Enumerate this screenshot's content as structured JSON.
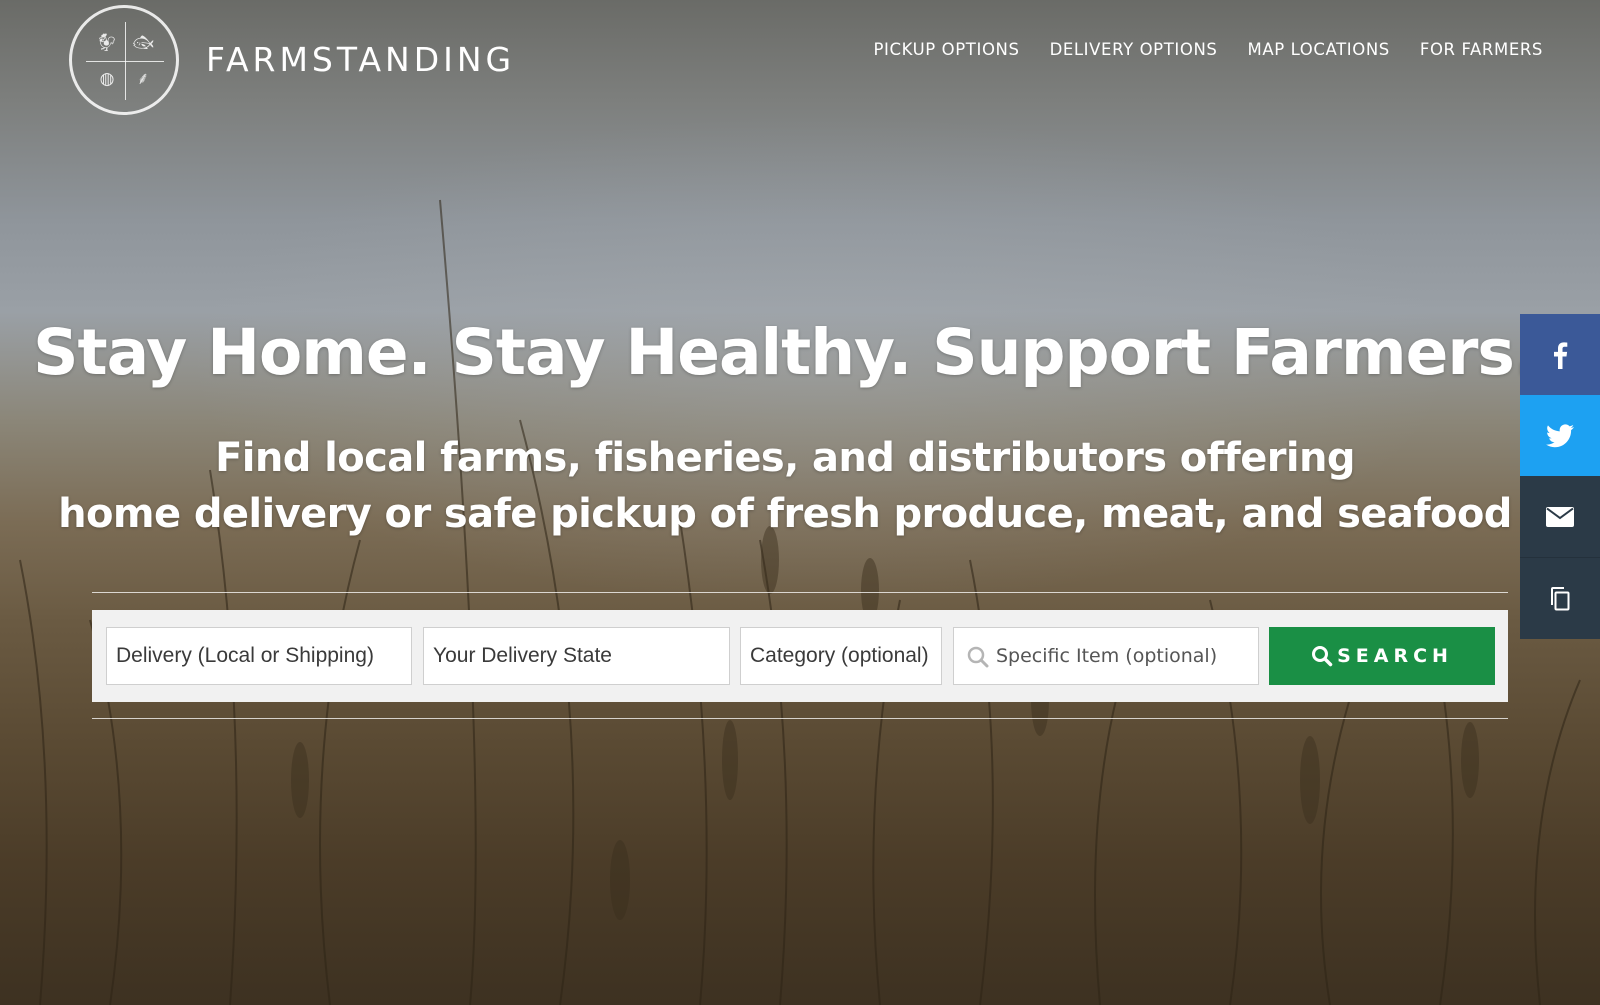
{
  "brand": {
    "name": "FARMSTANDING",
    "logo_icons": [
      "chicken-icon",
      "fish-icon",
      "basket-icon",
      "plant-icon"
    ]
  },
  "nav": {
    "items": [
      {
        "label": "PICKUP OPTIONS"
      },
      {
        "label": "DELIVERY OPTIONS"
      },
      {
        "label": "MAP LOCATIONS"
      },
      {
        "label": "FOR FARMERS"
      }
    ]
  },
  "hero": {
    "headline": "Stay Home. Stay Healthy. Support Farmers.",
    "subhead_line1": "Find local farms, fisheries, and distributors offering",
    "subhead_line2": "home delivery or safe pickup of fresh produce, meat, and seafood"
  },
  "search": {
    "delivery_select": "Delivery (Local or Shipping)",
    "state_select": "Your Delivery State",
    "category_select": "Category (optional)",
    "item_placeholder": "Specific Item (optional)",
    "button_label": "SEARCH"
  },
  "share": {
    "icons": [
      "facebook-icon",
      "twitter-icon",
      "email-icon",
      "copy-icon"
    ]
  },
  "colors": {
    "accent_green": "#1a8f45",
    "facebook": "#3b5998",
    "twitter": "#1da1f2",
    "share_dark": "#2b3a47"
  }
}
